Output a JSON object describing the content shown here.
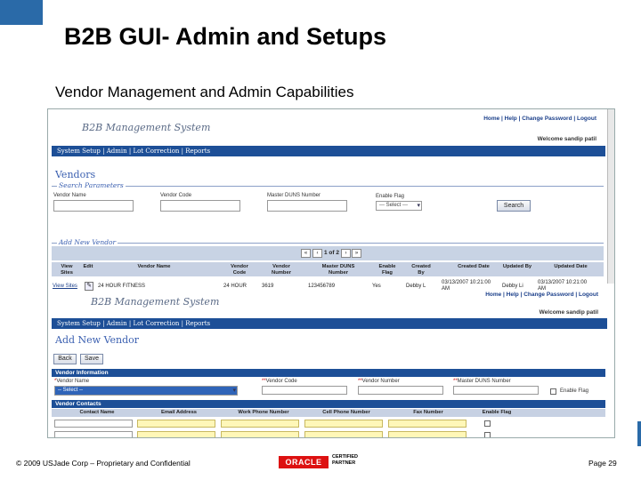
{
  "slide": {
    "title": "B2B GUI- Admin and Setups",
    "subtitle": "Vendor Management and Admin Capabilities",
    "footer": "© 2009 USJade Corp – Proprietary and Confidential",
    "oracle_logo": "ORACLE",
    "partner_line1": "CERTIFIED",
    "partner_line2": "PARTNER",
    "page": "Page 29"
  },
  "vendors_page": {
    "app_title": "B2B Management System",
    "top_links": "Home | Help | Change Password | Logout",
    "welcome": "Welcome sandip patil",
    "nav": "System Setup | Admin | Lot Correction | Reports",
    "section_title": "Vendors",
    "search_legend": "Search Parameters",
    "labels": {
      "vendor_name": "Vendor Name",
      "vendor_code": "Vendor Code",
      "master_duns": "Master DUNS Number",
      "enable_flag": "Enable Flag"
    },
    "enable_flag_value": "--- Select ---",
    "search_button": "Search",
    "add_new_vendor_legend": "Add New Vendor",
    "pager": "1 of 2",
    "columns": [
      "View Sites",
      "Edit",
      "Vendor Name",
      "Vendor Code",
      "Vendor Number",
      "Master DUNS Number",
      "Enable Flag",
      "Created By",
      "Created Date",
      "Updated By",
      "Updated Date"
    ],
    "row": {
      "view_sites": "View Sites",
      "vendor_name": "24 HOUR FITNESS",
      "vendor_code": "24 HOUR",
      "vendor_number": "3619",
      "duns": "123456789",
      "enable_flag": "Yes",
      "created_by": "Debby L",
      "created_date": "03/13/2007 10:21:00 AM",
      "updated_by": "Debby Li",
      "updated_date": "03/13/2007 10:21:00 AM"
    }
  },
  "add_vendor_page": {
    "app_title": "B2B Management System",
    "top_links": "Home | Help | Change Password | Logout",
    "welcome": "Welcome sandip patil",
    "nav": "System Setup | Admin | Lot Correction | Reports",
    "section_title": "Add New Vendor",
    "back_button": "Back",
    "save_button": "Save",
    "vendor_info_header": "Vendor Information",
    "labels": {
      "vendor_name": "Vendor Name",
      "vendor_code": "Vendor Code",
      "vendor_number": "Vendor Number",
      "master_duns": "Master DUNS Number",
      "enable_flag": "Enable Flag"
    },
    "vendor_name_select": "-- Select --",
    "vendor_contacts_header": "Vendor Contacts",
    "contact_columns": [
      "Contact Name",
      "Email Address",
      "Work Phone Number",
      "Cell Phone Number",
      "Fax Number",
      "Enable Flag"
    ]
  }
}
